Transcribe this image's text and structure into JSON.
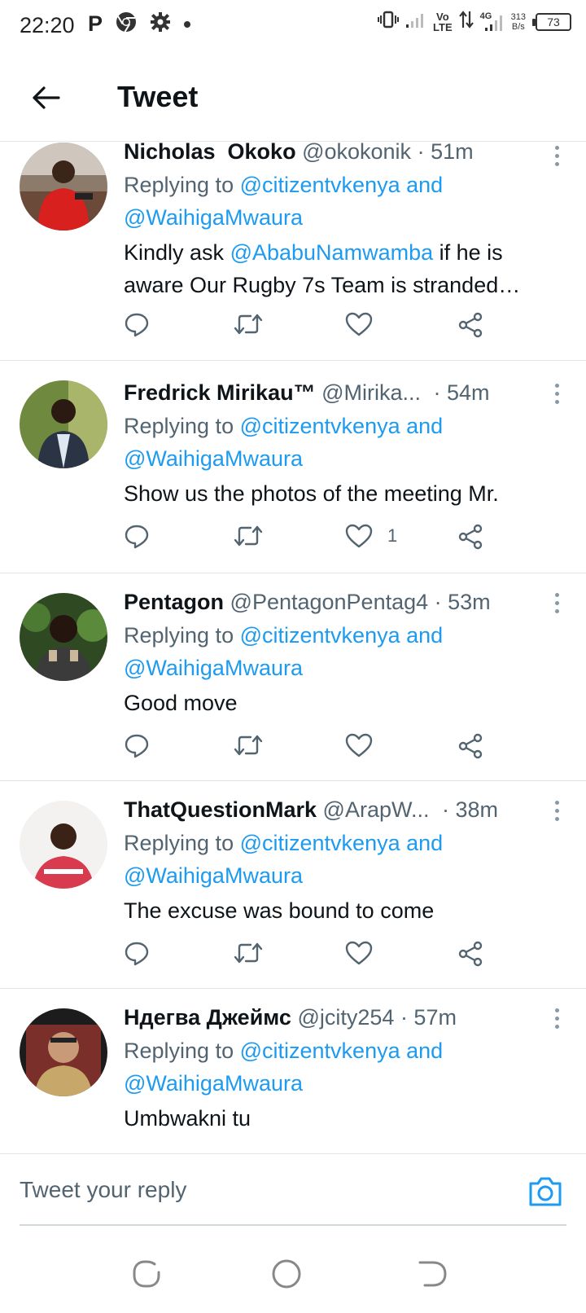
{
  "status_bar": {
    "time": "22:20",
    "notification_p": "P",
    "volte": "Vo\nLTE",
    "network_4g": "4G",
    "speed": "313\nB/s",
    "battery": "73",
    "icons": [
      "chrome-icon",
      "gear-icon",
      "vibrate-icon",
      "signal-icon",
      "data-arrows-icon"
    ]
  },
  "header": {
    "title": "Tweet",
    "back_icon": "arrow-left-icon"
  },
  "colors": {
    "accent": "#1d9bf0",
    "secondary_text": "#536471",
    "primary_text": "#0f1419"
  },
  "tweets": [
    {
      "name": "Nicholas  Okoko",
      "handle": "@okokonik",
      "time": "· 51m",
      "replying_prefix": "Replying to",
      "replying_to_1": "@citizentvkenya",
      "replying_and": "and",
      "replying_to_2": "@WaihigaMwaura",
      "text_before": "Kindly ask",
      "text_mention": "@AbabuNamwamba",
      "text_after": "if he is aware Our Rugby 7s Team is stranded…",
      "like_count": ""
    },
    {
      "name": "Fredrick Mirikau™",
      "handle": "@Mirika...",
      "time": "· 54m",
      "replying_prefix": "Replying to",
      "replying_to_1": "@citizentvkenya",
      "replying_and": "and",
      "replying_to_2": "@WaihigaMwaura",
      "text": "Show us the photos of the meeting Mr.",
      "like_count": "1"
    },
    {
      "name": "Pentagon",
      "handle": "@PentagonPentag4",
      "time": "· 53m",
      "replying_prefix": "Replying to",
      "replying_to_1": "@citizentvkenya",
      "replying_and": "and",
      "replying_to_2": "@WaihigaMwaura",
      "text": "Good move",
      "like_count": ""
    },
    {
      "name": "ThatQuestionMark",
      "handle": "@ArapW...",
      "time": "· 38m",
      "replying_prefix": "Replying to",
      "replying_to_1": "@citizentvkenya",
      "replying_and": "and",
      "replying_to_2": "@WaihigaMwaura",
      "text": "The excuse was bound to come",
      "like_count": ""
    },
    {
      "name": "Ндегва Джеймс",
      "handle": "@jcity254",
      "time": "· 57m",
      "replying_prefix": "Replying to",
      "replying_to_1": "@citizentvkenya",
      "replying_and": "and",
      "replying_to_2": "@WaihigaMwaura",
      "text": "Umbwakni tu",
      "like_count": ""
    }
  ],
  "reply_bar": {
    "placeholder": "Tweet your reply",
    "camera_icon": "camera-icon"
  },
  "nav_bar": {
    "icons": [
      "recents-icon",
      "home-circle-icon",
      "back-nav-icon"
    ]
  }
}
